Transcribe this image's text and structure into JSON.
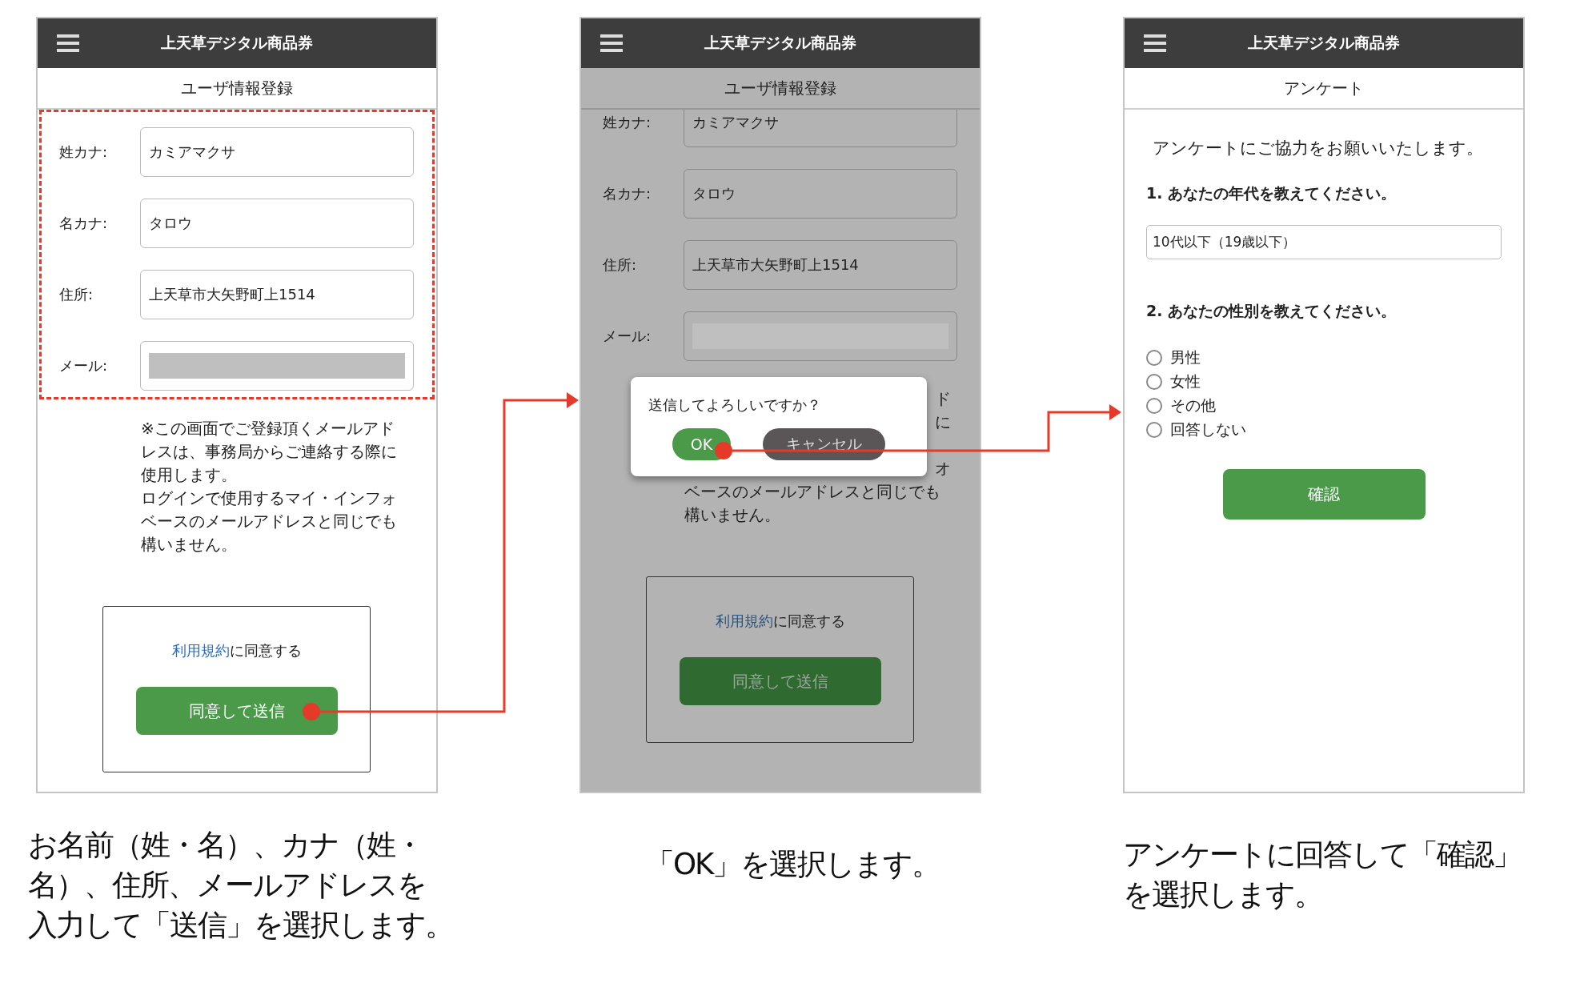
{
  "steps": [
    {
      "screen": {
        "kind": "registration",
        "dimmed": false,
        "highlighted": true,
        "app_title": "上天草デジタル商品券",
        "page_title": "ユーザ情報登録",
        "fields": [
          {
            "label": "姓カナ:",
            "value": "カミアマクサ"
          },
          {
            "label": "名カナ:",
            "value": "タロウ"
          },
          {
            "label": "住所:",
            "value": "上天草市大矢野町上1514"
          },
          {
            "label": "メール:",
            "redacted": true
          }
        ],
        "note": [
          {
            "kind": "full",
            "text": "※この画面でご登録頂くメールアドレスは、事務局からご連絡する際に使用します。"
          },
          {
            "kind": "full",
            "text": "ログインで使用するマイ・インフォベースのメールアドレスと同じでも構いません。"
          }
        ],
        "terms": {
          "link": "利用規約",
          "text": "に同意する"
        },
        "submit_button": "同意して送信"
      },
      "caption": [
        "お名前（姓・名）、カナ（姓・",
        "名）、住所、メールアドレスを",
        "入力して「送信」を選択します。"
      ]
    },
    {
      "screen": {
        "kind": "registration",
        "dimmed": true,
        "highlighted": false,
        "app_title": "上天草デジタル商品券",
        "page_title": "ユーザ情報登録",
        "fields": [
          {
            "label": "姓カナ:",
            "value": "カミアマクサ"
          },
          {
            "label": "名カナ:",
            "value": "タロウ"
          },
          {
            "label": "住所:",
            "value": "上天草市大矢野町上1514"
          },
          {
            "label": "メール:",
            "redacted": true
          }
        ],
        "note": [
          {
            "kind": "tail",
            "text": "ド"
          },
          {
            "kind": "tail",
            "text": "に"
          },
          {
            "kind": "covered"
          },
          {
            "kind": "tail",
            "text": "オ"
          },
          {
            "kind": "line",
            "text": "ベースのメールアドレスと同じでも"
          },
          {
            "kind": "line",
            "text": "構いません。"
          }
        ],
        "terms": {
          "link": "利用規約",
          "text": "に同意する"
        },
        "submit_button": "同意して送信",
        "dialog": {
          "message": "送信してよろしいですか？",
          "ok_button": "OK",
          "cancel_button": "キャンセル"
        }
      },
      "caption": [
        "「OK」を選択します。"
      ]
    },
    {
      "screen": {
        "kind": "survey",
        "dimmed": false,
        "app_title": "上天草デジタル商品券",
        "page_title": "アンケート",
        "intro": "アンケートにご協力をお願いいたします。",
        "questions": [
          {
            "kind": "select",
            "text": "1. あなたの年代を教えてください。",
            "value": "10代以下（19歳以下）"
          },
          {
            "kind": "radio",
            "text": "2. あなたの性別を教えてください。",
            "options": [
              {
                "label": "男性",
                "selected": false
              },
              {
                "label": "女性",
                "selected": false
              },
              {
                "label": "その他",
                "selected": false
              },
              {
                "label": "回答しない",
                "selected": false
              }
            ]
          }
        ],
        "confirm_button": "確認"
      },
      "caption": [
        "アンケートに回答して「確認」",
        "を選択します。"
      ]
    }
  ]
}
